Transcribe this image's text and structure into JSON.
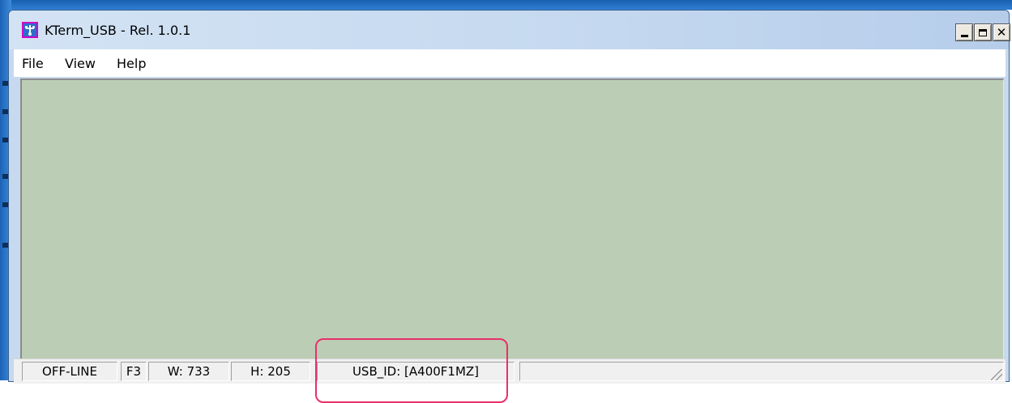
{
  "window": {
    "title": "KTerm_USB - Rel. 1.0.1",
    "icon": "usb-app-icon",
    "controls": {
      "minimize": "_",
      "maximize": "□",
      "close": "✕"
    }
  },
  "menu": {
    "items": [
      "File",
      "View",
      "Help"
    ]
  },
  "client": {
    "background_color": "#bccdb5"
  },
  "statusbar": {
    "connection": "OFF-LINE",
    "font": "F3",
    "width": "W:  733",
    "height": "H:  205",
    "usb_id": "USB_ID: [A400F1MZ]"
  },
  "annotation": {
    "highlight_color": "#e8306a"
  }
}
